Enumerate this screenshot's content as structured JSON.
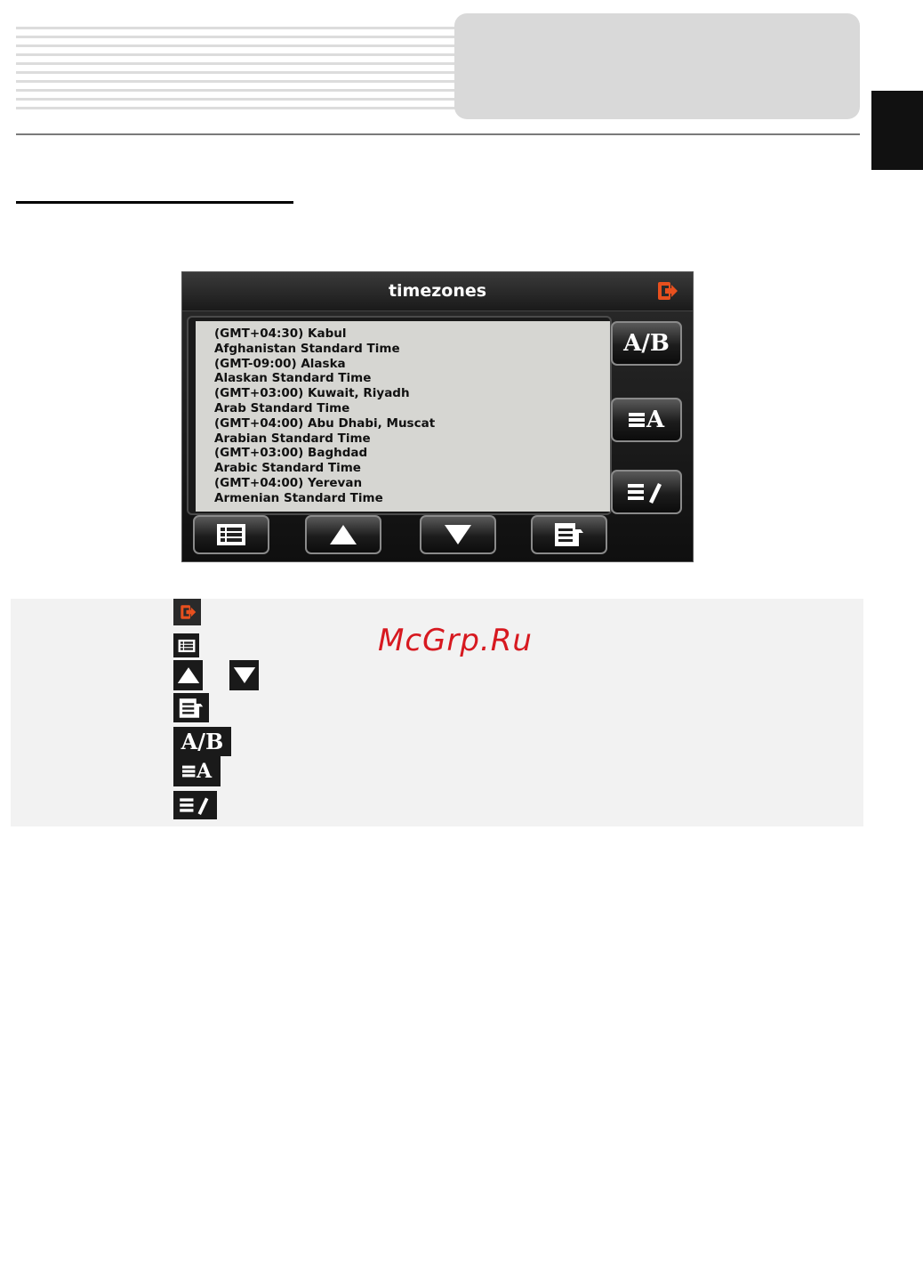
{
  "device": {
    "title": "timezones",
    "list_items": [
      "(GMT+04:30) Kabul",
      "Afghanistan Standard Time",
      "(GMT-09:00) Alaska",
      "Alaskan Standard Time",
      "(GMT+03:00) Kuwait, Riyadh",
      "Arab Standard Time",
      "(GMT+04:00) Abu Dhabi, Muscat",
      "Arabian Standard Time",
      "(GMT+03:00) Baghdad",
      "Arabic Standard Time",
      "(GMT+04:00) Yerevan",
      "Armenian Standard Time"
    ],
    "side_buttons": {
      "ab_label": "A/B",
      "sort_label": "A"
    },
    "icons": {
      "exit": "exit-icon",
      "list_view": "list-view-icon",
      "scroll_up": "arrow-up-icon",
      "scroll_down": "arrow-down-icon",
      "details": "details-icon",
      "ab": "ab-icon",
      "sort_alpha": "sort-alpha-icon",
      "edit": "edit-icon"
    },
    "accent_color": "#e8501e"
  },
  "legend": {
    "ab_label": "A/B",
    "sort_label": "A"
  },
  "watermark": "McGrp.Ru"
}
